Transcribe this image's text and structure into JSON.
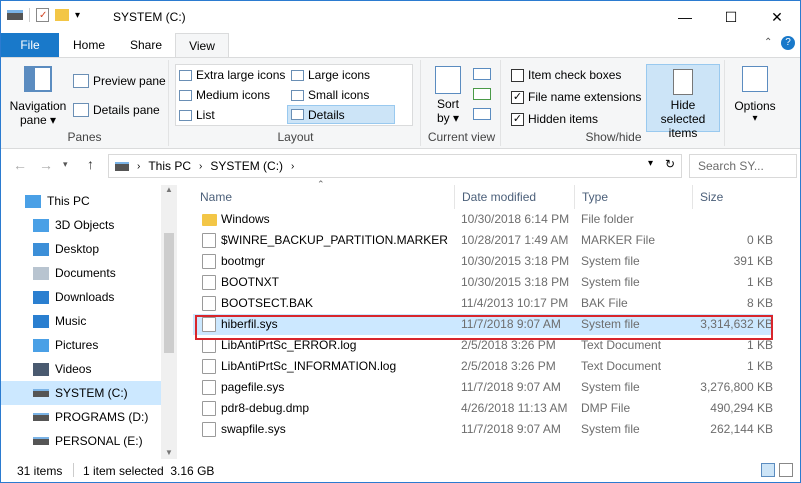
{
  "window": {
    "title": "SYSTEM (C:)",
    "minimize_glyph": "—",
    "maximize_glyph": "☐",
    "close_glyph": "✕"
  },
  "tabs": {
    "file": "File",
    "home": "Home",
    "share": "Share",
    "view": "View"
  },
  "ribbon": {
    "panes": {
      "navigation_pane_line1": "Navigation",
      "navigation_pane_line2": "pane ▾",
      "preview_pane": "Preview pane",
      "details_pane": "Details pane",
      "group_label": "Panes"
    },
    "layout": {
      "extra_large_icons": "Extra large icons",
      "large_icons": "Large icons",
      "medium_icons": "Medium icons",
      "small_icons": "Small icons",
      "list": "List",
      "details": "Details",
      "group_label": "Layout"
    },
    "current_view": {
      "sort_line1": "Sort",
      "sort_line2": "by ▾",
      "group_label": "Current view"
    },
    "show_hide": {
      "item_check_boxes": "Item check boxes",
      "file_name_extensions": "File name extensions",
      "hidden_items": "Hidden items",
      "hide_selected_line1": "Hide selected",
      "hide_selected_line2": "items",
      "group_label": "Show/hide"
    },
    "options": {
      "label": "Options",
      "dropdown": "▾"
    }
  },
  "checkboxes": {
    "item_check_boxes": false,
    "file_name_extensions": true,
    "hidden_items": true
  },
  "address": {
    "path": [
      "This PC",
      "SYSTEM (C:)"
    ],
    "search_placeholder": "Search SY..."
  },
  "navigation": [
    {
      "label": "This PC",
      "icon": "monitor-icon"
    },
    {
      "label": "3D Objects",
      "icon": "cube-icon"
    },
    {
      "label": "Desktop",
      "icon": "desktop-icon"
    },
    {
      "label": "Documents",
      "icon": "documents-icon"
    },
    {
      "label": "Downloads",
      "icon": "download-arrow-icon"
    },
    {
      "label": "Music",
      "icon": "music-note-icon"
    },
    {
      "label": "Pictures",
      "icon": "pictures-icon"
    },
    {
      "label": "Videos",
      "icon": "video-icon"
    },
    {
      "label": "SYSTEM (C:)",
      "icon": "drive-icon"
    },
    {
      "label": "PROGRAMS (D:)",
      "icon": "drive-icon"
    },
    {
      "label": "PERSONAL (E:)",
      "icon": "drive-icon"
    }
  ],
  "columns": {
    "name": "Name",
    "date_modified": "Date modified",
    "type": "Type",
    "size": "Size"
  },
  "files": [
    {
      "name": "Windows",
      "date": "10/30/2018 6:14 PM",
      "type": "File folder",
      "size": "",
      "folder": true
    },
    {
      "name": "$WINRE_BACKUP_PARTITION.MARKER",
      "date": "10/28/2017 1:49 AM",
      "type": "MARKER File",
      "size": "0 KB"
    },
    {
      "name": "bootmgr",
      "date": "10/30/2015 3:18 PM",
      "type": "System file",
      "size": "391 KB"
    },
    {
      "name": "BOOTNXT",
      "date": "10/30/2015 3:18 PM",
      "type": "System file",
      "size": "1 KB"
    },
    {
      "name": "BOOTSECT.BAK",
      "date": "11/4/2013 10:17 PM",
      "type": "BAK File",
      "size": "8 KB"
    },
    {
      "name": "hiberfil.sys",
      "date": "11/7/2018 9:07 AM",
      "type": "System file",
      "size": "3,314,632 KB",
      "selected": true
    },
    {
      "name": "LibAntiPrtSc_ERROR.log",
      "date": "2/5/2018 3:26 PM",
      "type": "Text Document",
      "size": "1 KB"
    },
    {
      "name": "LibAntiPrtSc_INFORMATION.log",
      "date": "2/5/2018 3:26 PM",
      "type": "Text Document",
      "size": "1 KB"
    },
    {
      "name": "pagefile.sys",
      "date": "11/7/2018 9:07 AM",
      "type": "System file",
      "size": "3,276,800 KB"
    },
    {
      "name": "pdr8-debug.dmp",
      "date": "4/26/2018 11:13 AM",
      "type": "DMP File",
      "size": "490,294 KB"
    },
    {
      "name": "swapfile.sys",
      "date": "11/7/2018 9:07 AM",
      "type": "System file",
      "size": "262,144 KB"
    }
  ],
  "status": {
    "items_count": "31 items",
    "selection": "1 item selected  3.16 GB"
  },
  "colors": {
    "accent": "#1979ca",
    "selection": "#cce8ff",
    "highlight_border": "#d8262c"
  }
}
